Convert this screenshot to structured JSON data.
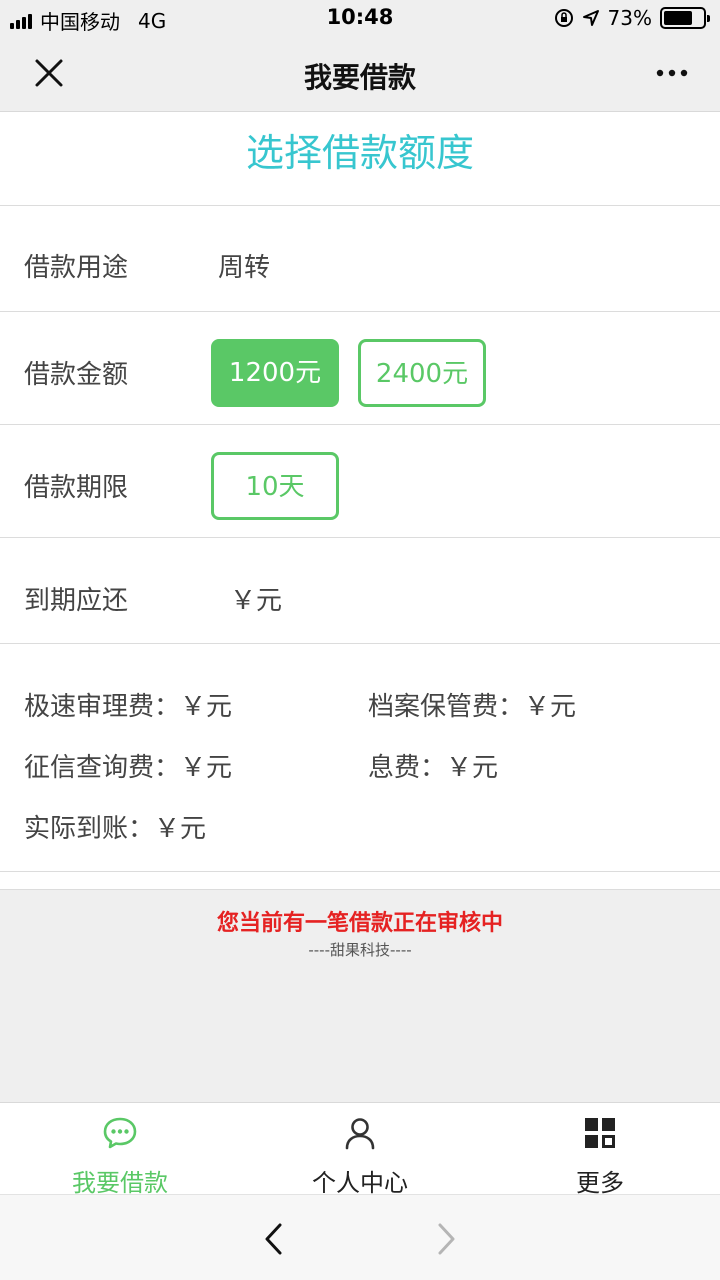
{
  "status_bar": {
    "carrier": "中国移动",
    "network": "4G",
    "time": "10:48",
    "battery": "73%",
    "battery_level": 0.73
  },
  "nav": {
    "title": "我要借款",
    "close_icon": "close-icon",
    "more_icon": "more-icon"
  },
  "page_heading": "选择借款额度",
  "form": {
    "purpose": {
      "label": "借款用途",
      "value": "周转"
    },
    "amount": {
      "label": "借款金额",
      "options": [
        {
          "label": "1200元",
          "selected": true
        },
        {
          "label": "2400元",
          "selected": false
        }
      ]
    },
    "term": {
      "label": "借款期限",
      "options": [
        {
          "label": "10天",
          "selected": false
        }
      ]
    },
    "due": {
      "label": "到期应还",
      "value": "￥元"
    }
  },
  "fees": {
    "express_review": "极速审理费：￥元",
    "archive_custody": "档案保管费：￥元",
    "credit_query": "征信查询费：￥元",
    "interest": "息费：￥元",
    "actual_received": "实际到账：￥元"
  },
  "notice": {
    "main": "您当前有一笔借款正在审核中",
    "sub": "----甜果科技----"
  },
  "tabs": [
    {
      "label": "我要借款",
      "icon": "chat-bubble-icon",
      "active": true
    },
    {
      "label": "个人中心",
      "icon": "person-icon",
      "active": false
    },
    {
      "label": "更多",
      "icon": "grid-icon",
      "active": false
    }
  ],
  "colors": {
    "accent_green": "#5ac866",
    "heading_cyan": "#37c6cf",
    "notice_red": "#e52222"
  }
}
